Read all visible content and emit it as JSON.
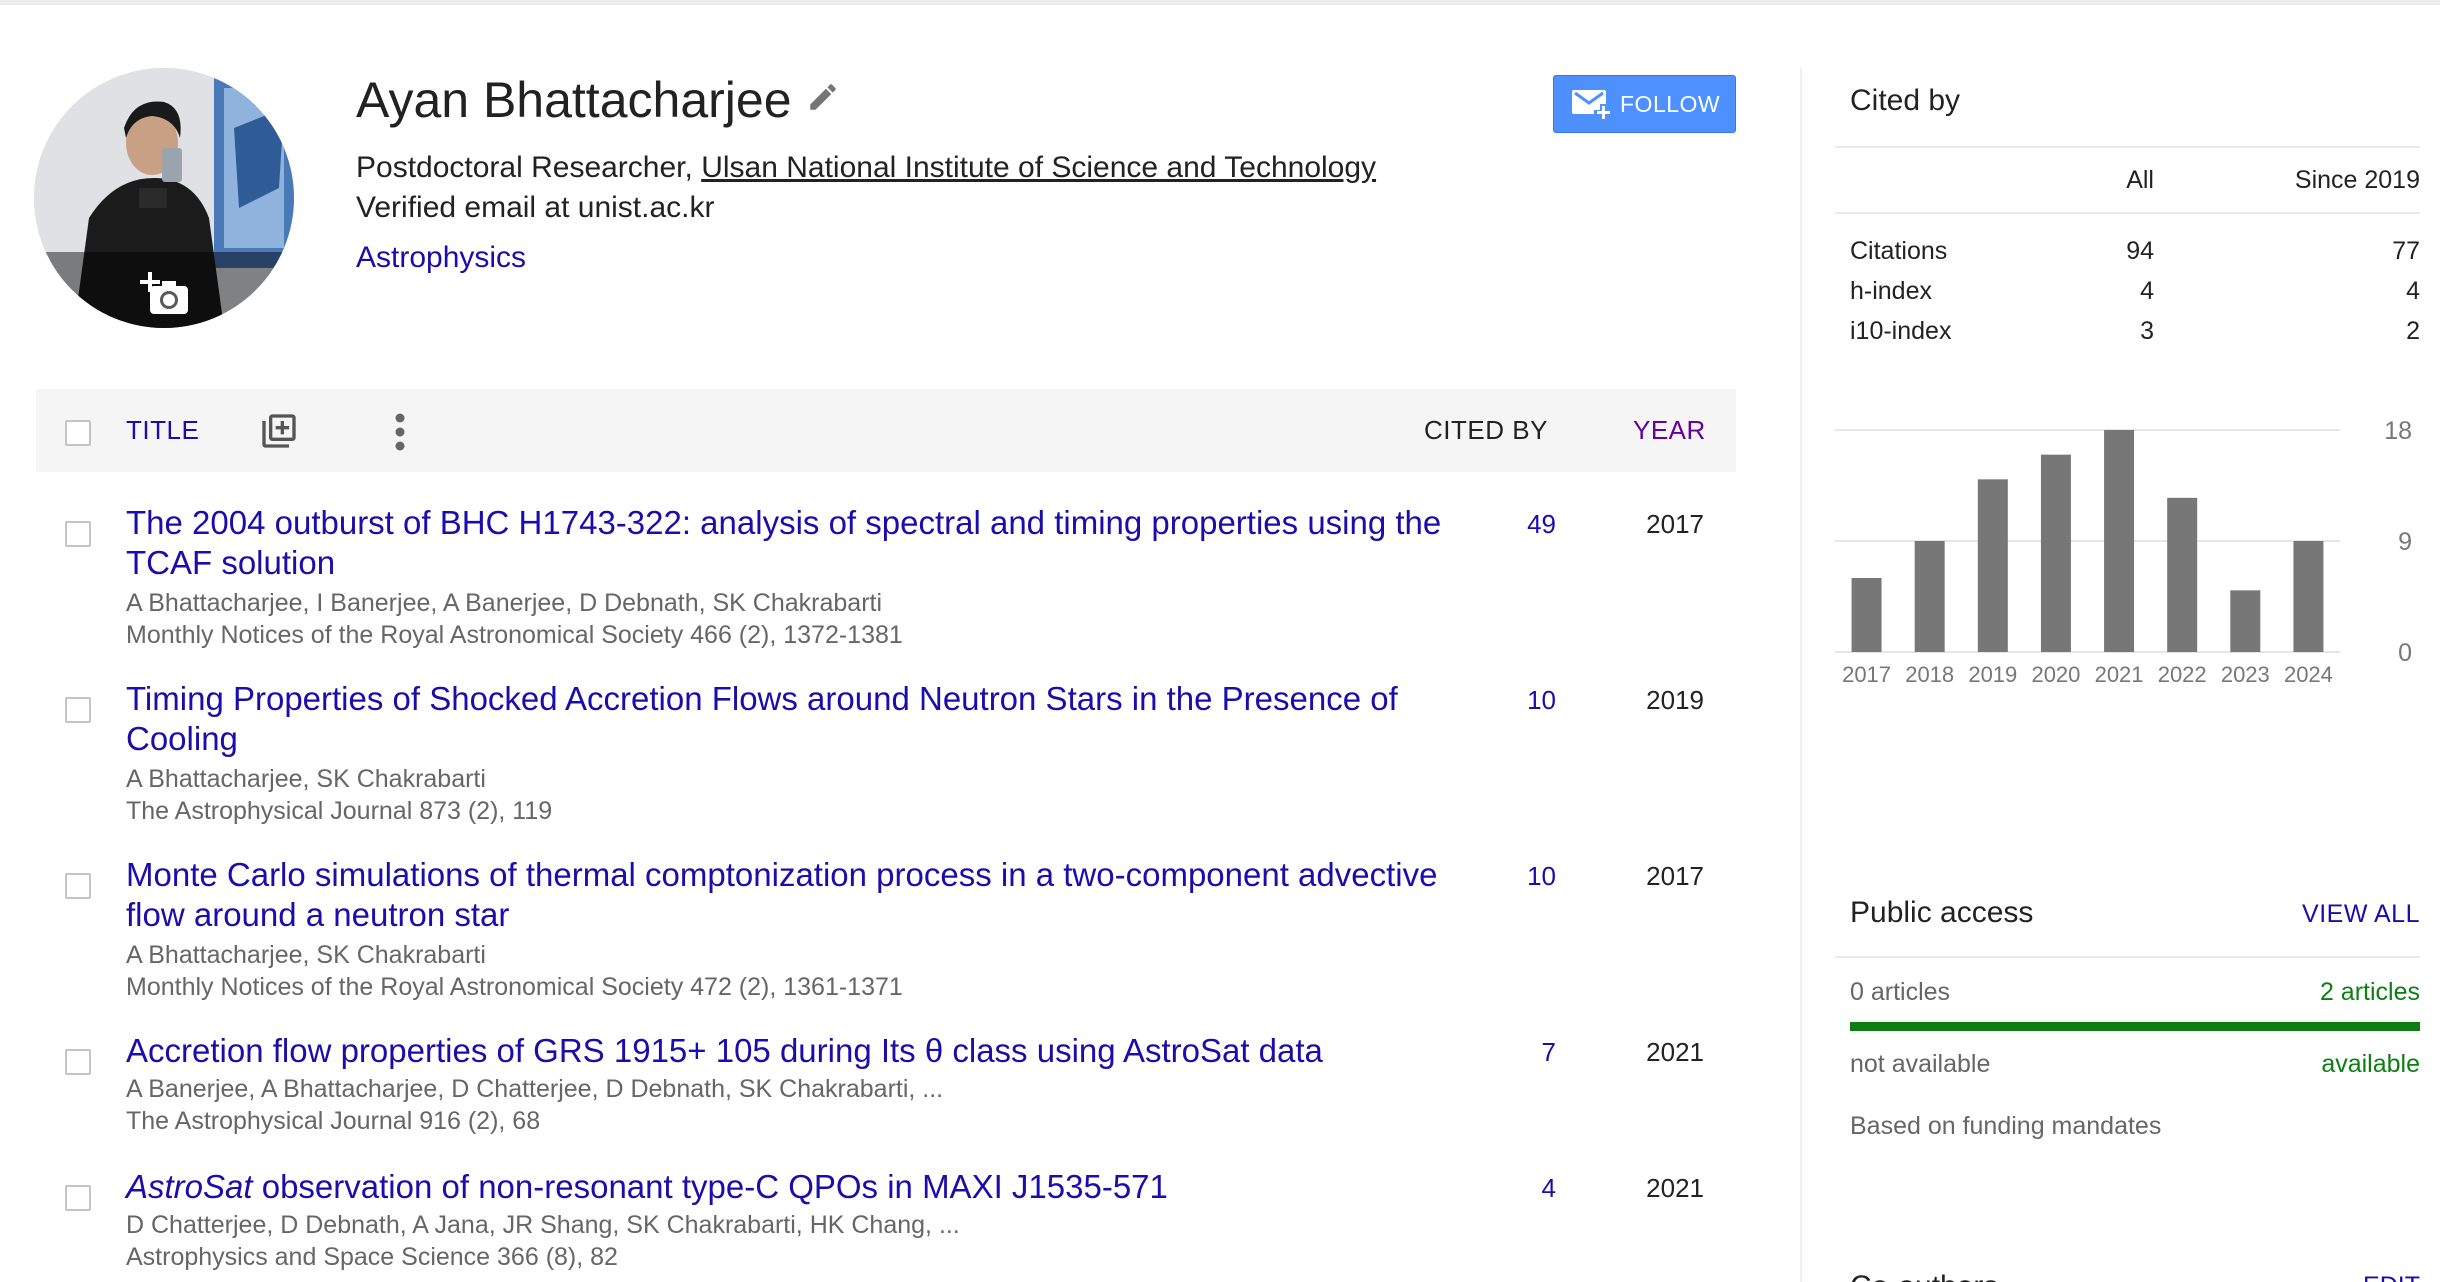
{
  "profile": {
    "name": "Ayan Bhattacharjee",
    "position": "Postdoctoral Researcher, ",
    "institution": "Ulsan National Institute of Science and Technology",
    "email": "Verified email at unist.ac.kr",
    "interest": "Astrophysics",
    "follow_label": "FOLLOW"
  },
  "table": {
    "header": {
      "title": "TITLE",
      "cited_by": "CITED BY",
      "year": "YEAR"
    },
    "rows": [
      {
        "title": "The 2004 outburst of BHC H1743-322: analysis of spectral and timing properties using the TCAF solution",
        "authors": "A Bhattacharjee, I Banerjee, A Banerjee, D Debnath, SK Chakrabarti",
        "venue": "Monthly Notices of the Royal Astronomical Society 466 (2), 1372-1381",
        "cited_by": "49",
        "year": "2017"
      },
      {
        "title": "Timing Properties of Shocked Accretion Flows around Neutron Stars in the Presence of Cooling",
        "authors": "A Bhattacharjee, SK Chakrabarti",
        "venue": "The Astrophysical Journal 873 (2), 119",
        "cited_by": "10",
        "year": "2019"
      },
      {
        "title": "Monte Carlo simulations of thermal comptonization process in a two-component advective flow around a neutron star",
        "authors": "A Bhattacharjee, SK Chakrabarti",
        "venue": "Monthly Notices of the Royal Astronomical Society 472 (2), 1361-1371",
        "cited_by": "10",
        "year": "2017"
      },
      {
        "title": "Accretion flow properties of GRS 1915+ 105 during Its θ class using AstroSat data",
        "authors": "A Banerjee, A Bhattacharjee, D Chatterjee, D Debnath, SK Chakrabarti, ...",
        "venue": "The Astrophysical Journal 916 (2), 68",
        "cited_by": "7",
        "year": "2021"
      },
      {
        "title_italic": "AstroSat",
        "title_rest": " observation of non-resonant type-C QPOs in MAXI J1535-571",
        "authors": "D Chatterjee, D Debnath, A Jana, JR Shang, SK Chakrabarti, HK Chang, ...",
        "venue": "Astrophysics and Space Science 366 (8), 82",
        "cited_by": "4",
        "year": "2021"
      }
    ]
  },
  "cited_by": {
    "title": "Cited by",
    "col_all": "All",
    "col_since": "Since 2019",
    "metrics": [
      {
        "label": "Citations",
        "all": "94",
        "since": "77"
      },
      {
        "label": "h-index",
        "all": "4",
        "since": "4"
      },
      {
        "label": "i10-index",
        "all": "3",
        "since": "2"
      }
    ]
  },
  "chart_data": {
    "type": "bar",
    "categories": [
      "2017",
      "2018",
      "2019",
      "2020",
      "2021",
      "2022",
      "2023",
      "2024"
    ],
    "values": [
      6,
      9,
      14,
      16,
      18,
      12.5,
      5,
      9
    ],
    "yticks": [
      "18",
      "9",
      "0"
    ],
    "ylim": [
      0,
      18
    ],
    "bar_color": "#777777",
    "grid": true
  },
  "public_access": {
    "title": "Public access",
    "view_all": "VIEW ALL",
    "left_count": "0 articles",
    "right_count": "2 articles",
    "left_status": "not available",
    "right_status": "available",
    "note": "Based on funding mandates",
    "available_fraction": 1.0,
    "available_color": "#0d7f12"
  },
  "coauthors": {
    "title": "Co-authors",
    "edit": "EDIT"
  }
}
